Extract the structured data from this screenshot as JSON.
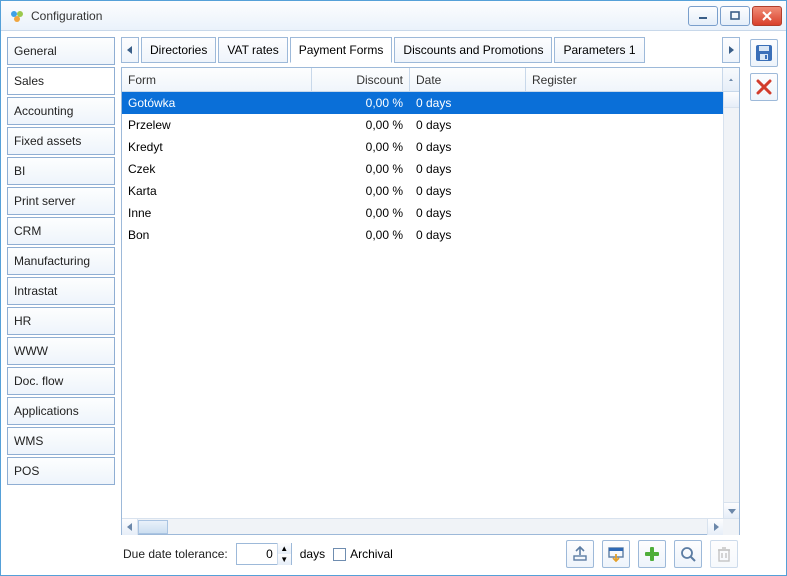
{
  "window": {
    "title": "Configuration"
  },
  "sidebar": {
    "items": [
      {
        "label": "General"
      },
      {
        "label": "Sales"
      },
      {
        "label": "Accounting"
      },
      {
        "label": "Fixed assets"
      },
      {
        "label": "BI"
      },
      {
        "label": "Print server"
      },
      {
        "label": "CRM"
      },
      {
        "label": "Manufacturing"
      },
      {
        "label": "Intrastat"
      },
      {
        "label": "HR"
      },
      {
        "label": "WWW"
      },
      {
        "label": "Doc. flow"
      },
      {
        "label": "Applications"
      },
      {
        "label": "WMS"
      },
      {
        "label": "POS"
      }
    ],
    "active_index": 1
  },
  "tabs": {
    "items": [
      {
        "label": "Directories"
      },
      {
        "label": "VAT rates"
      },
      {
        "label": "Payment Forms"
      },
      {
        "label": "Discounts and Promotions"
      },
      {
        "label": "Parameters 1"
      }
    ],
    "active_index": 2
  },
  "table": {
    "columns": {
      "form": "Form",
      "discount": "Discount",
      "date": "Date",
      "register": "Register"
    },
    "rows": [
      {
        "form": "Gotówka",
        "discount": "0,00 %",
        "date": "0 days",
        "register": ""
      },
      {
        "form": "Przelew",
        "discount": "0,00 %",
        "date": "0 days",
        "register": ""
      },
      {
        "form": "Kredyt",
        "discount": "0,00 %",
        "date": "0 days",
        "register": ""
      },
      {
        "form": "Czek",
        "discount": "0,00 %",
        "date": "0 days",
        "register": ""
      },
      {
        "form": "Karta",
        "discount": "0,00 %",
        "date": "0 days",
        "register": ""
      },
      {
        "form": "Inne",
        "discount": "0,00 %",
        "date": "0 days",
        "register": ""
      },
      {
        "form": "Bon",
        "discount": "0,00 %",
        "date": "0 days",
        "register": ""
      }
    ],
    "selected_index": 0
  },
  "footer": {
    "tolerance_label": "Due date tolerance:",
    "tolerance_value": "0",
    "tolerance_unit": "days",
    "archival_label": "Archival"
  }
}
